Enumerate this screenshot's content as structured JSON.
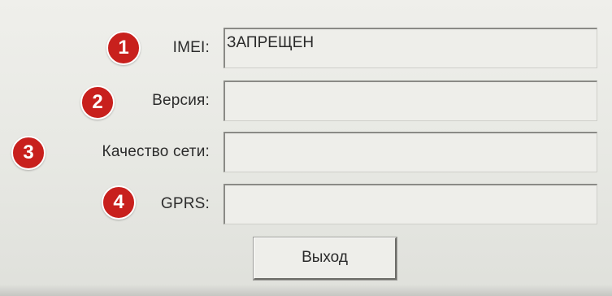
{
  "form": {
    "rows": [
      {
        "badge": "1",
        "label": "IMEI:",
        "value": "ЗАПРЕЩЕН"
      },
      {
        "badge": "2",
        "label": "Версия:",
        "value": ""
      },
      {
        "badge": "3",
        "label": "Качество сети:",
        "value": ""
      },
      {
        "badge": "4",
        "label": "GPRS:",
        "value": ""
      }
    ]
  },
  "actions": {
    "exit_label": "Выход"
  },
  "colors": {
    "badge_red": "#c8201d",
    "background": "#e9e9e5"
  }
}
